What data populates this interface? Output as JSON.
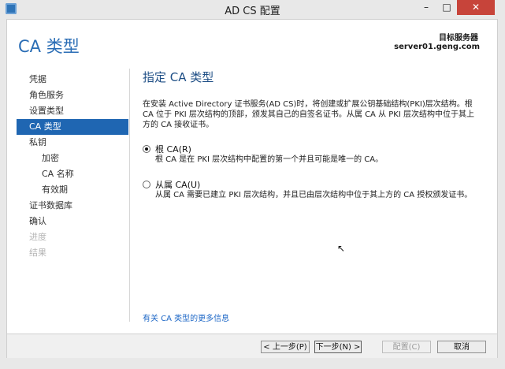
{
  "window": {
    "title": "AD CS 配置",
    "controls": {
      "min": "–",
      "max": "□",
      "close": "✕"
    }
  },
  "header": {
    "page_title": "CA 类型",
    "server_label": "目标服务器",
    "server_name": "server01.geng.com"
  },
  "sidebar": {
    "items": [
      {
        "label": "凭据",
        "state": "normal",
        "level": 0
      },
      {
        "label": "角色服务",
        "state": "normal",
        "level": 0
      },
      {
        "label": "设置类型",
        "state": "normal",
        "level": 0
      },
      {
        "label": "CA 类型",
        "state": "active",
        "level": 0
      },
      {
        "label": "私钥",
        "state": "normal",
        "level": 0
      },
      {
        "label": "加密",
        "state": "normal",
        "level": 1
      },
      {
        "label": "CA 名称",
        "state": "normal",
        "level": 1
      },
      {
        "label": "有效期",
        "state": "normal",
        "level": 1
      },
      {
        "label": "证书数据库",
        "state": "normal",
        "level": 0
      },
      {
        "label": "确认",
        "state": "normal",
        "level": 0
      },
      {
        "label": "进度",
        "state": "disabled",
        "level": 0
      },
      {
        "label": "结果",
        "state": "disabled",
        "level": 0
      }
    ]
  },
  "main": {
    "section_title": "指定 CA 类型",
    "description": "在安装 Active Directory 证书服务(AD CS)时，将创建或扩展公钥基础结构(PKI)层次结构。根 CA 位于 PKI 层次结构的顶部，颁发其自己的自签名证书。从属 CA 从 PKI 层次结构中位于其上方的 CA 接收证书。",
    "options": [
      {
        "label": "根 CA(R)",
        "desc": "根 CA 是在 PKI 层次结构中配置的第一个并且可能是唯一的 CA。",
        "selected": true
      },
      {
        "label": "从属 CA(U)",
        "desc": "从属 CA 需要已建立 PKI 层次结构，并且已由层次结构中位于其上方的 CA 授权颁发证书。",
        "selected": false
      }
    ],
    "more_info": "有关 CA 类型的更多信息"
  },
  "footer": {
    "prev": "< 上一步(P)",
    "next": "下一步(N) >",
    "configure": "配置(C)",
    "cancel": "取消"
  }
}
